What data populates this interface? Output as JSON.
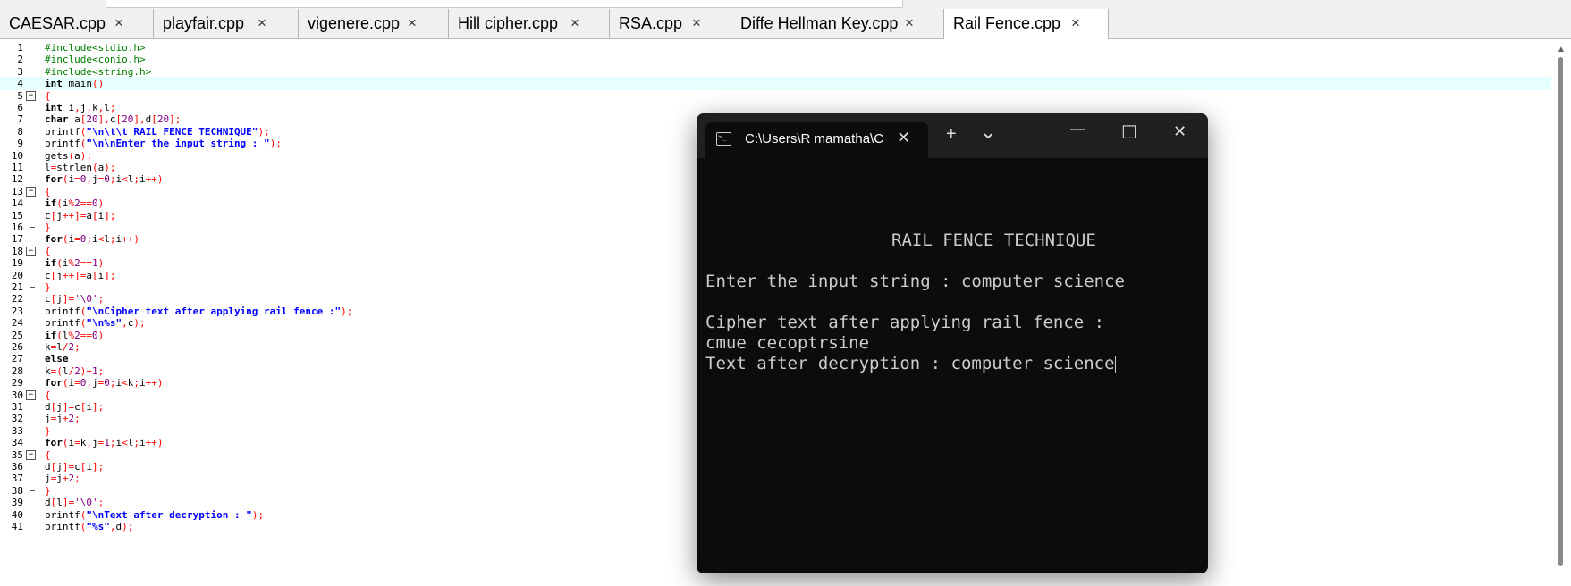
{
  "tabs": [
    {
      "label": "CAESAR.cpp",
      "close": "×"
    },
    {
      "label": "playfair.cpp",
      "close": "×"
    },
    {
      "label": "vigenere.cpp",
      "close": "×"
    },
    {
      "label": "Hill cipher.cpp",
      "close": "×"
    },
    {
      "label": "RSA.cpp",
      "close": "×"
    },
    {
      "label": "Diffe Hellman Key.cpp",
      "close": "×"
    },
    {
      "label": "Rail Fence.cpp",
      "close": "×"
    }
  ],
  "colors": {
    "keyword": "#000000",
    "preprocessor": "#008000",
    "symbol": "#ff0000",
    "string": "#0000ff",
    "number": "#800080",
    "current_line": "#e6ffff"
  },
  "code_lines": [
    {
      "n": "1",
      "text": "#include<stdio.h>"
    },
    {
      "n": "2",
      "text": "#include<conio.h>"
    },
    {
      "n": "3",
      "text": "#include<string.h>"
    },
    {
      "n": "4",
      "text": "int main()"
    },
    {
      "n": "5",
      "text": "{"
    },
    {
      "n": "6",
      "text": "int i,j,k,l;"
    },
    {
      "n": "7",
      "text": "char a[20],c[20],d[20];"
    },
    {
      "n": "8",
      "text": "printf(\"\\n\\t\\t RAIL FENCE TECHNIQUE\");"
    },
    {
      "n": "9",
      "text": "printf(\"\\n\\nEnter the input string : \");"
    },
    {
      "n": "10",
      "text": "gets(a);"
    },
    {
      "n": "11",
      "text": "l=strlen(a);"
    },
    {
      "n": "12",
      "text": "for(i=0,j=0;i<l;i++)"
    },
    {
      "n": "13",
      "text": "{"
    },
    {
      "n": "14",
      "text": "if(i%2==0)"
    },
    {
      "n": "15",
      "text": "c[j++]=a[i];"
    },
    {
      "n": "16",
      "text": "}"
    },
    {
      "n": "17",
      "text": "for(i=0;i<l;i++)"
    },
    {
      "n": "18",
      "text": "{"
    },
    {
      "n": "19",
      "text": "if(i%2==1)"
    },
    {
      "n": "20",
      "text": "c[j++]=a[i];"
    },
    {
      "n": "21",
      "text": "}"
    },
    {
      "n": "22",
      "text": "c[j]='\\0';"
    },
    {
      "n": "23",
      "text": "printf(\"\\nCipher text after applying rail fence :\");"
    },
    {
      "n": "24",
      "text": "printf(\"\\n%s\",c);"
    },
    {
      "n": "25",
      "text": "if(l%2==0)"
    },
    {
      "n": "26",
      "text": "k=l/2;"
    },
    {
      "n": "27",
      "text": "else"
    },
    {
      "n": "28",
      "text": "k=(l/2)+1;"
    },
    {
      "n": "29",
      "text": "for(i=0,j=0;i<k;i++)"
    },
    {
      "n": "30",
      "text": "{"
    },
    {
      "n": "31",
      "text": "d[j]=c[i];"
    },
    {
      "n": "32",
      "text": "j=j+2;"
    },
    {
      "n": "33",
      "text": "}"
    },
    {
      "n": "34",
      "text": "for(i=k,j=1;i<l;i++)"
    },
    {
      "n": "35",
      "text": "{"
    },
    {
      "n": "36",
      "text": "d[j]=c[i];"
    },
    {
      "n": "37",
      "text": "j=j+2;"
    },
    {
      "n": "38",
      "text": "}"
    },
    {
      "n": "39",
      "text": "d[l]='\\0';"
    },
    {
      "n": "40",
      "text": "printf(\"\\nText after decryption : \");"
    },
    {
      "n": "41",
      "text": "printf(\"%s\",d);"
    }
  ],
  "terminal": {
    "tab_title": "C:\\Users\\R mamatha\\C",
    "new_tab": "+",
    "dropdown": "⌄",
    "minimize": "—",
    "maximize": "☐",
    "close": "✕",
    "tab_close": "✕",
    "lines": [
      "\t\t RAIL FENCE TECHNIQUE",
      "",
      "Enter the input string : computer science",
      "",
      "Cipher text after applying rail fence :",
      "cmue cecoptrsine",
      "Text after decryption : computer science"
    ]
  }
}
